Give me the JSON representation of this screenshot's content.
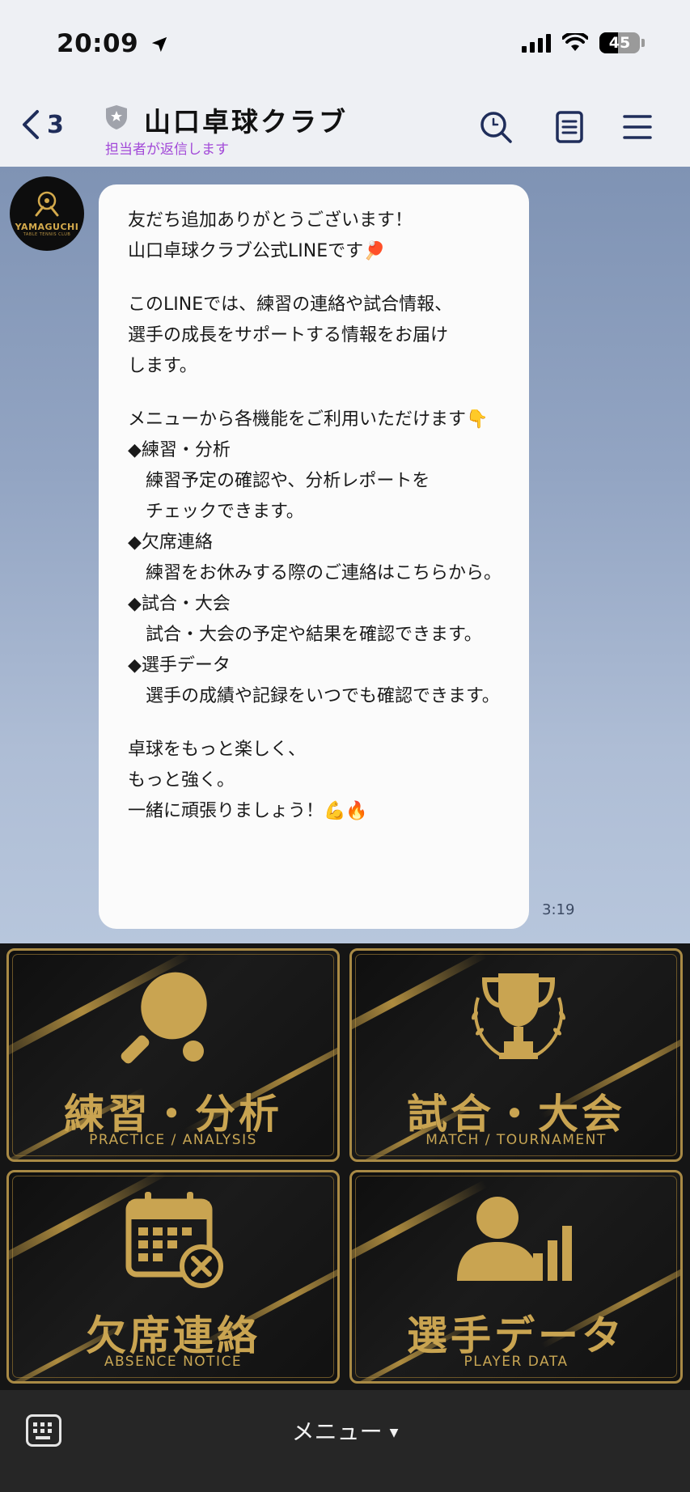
{
  "status": {
    "time": "20:09",
    "battery": "45",
    "battery_level": 0.45
  },
  "header": {
    "back_count": "3",
    "title": "山口卓球クラブ",
    "subtitle": "担当者が返信します"
  },
  "avatar": {
    "logo_text": "YAMAGUCHI",
    "logo_sub": "TABLE TENNIS CLUB"
  },
  "message": {
    "lines": [
      "友だち追加ありがとうございます！",
      "山口卓球クラブ公式LINEです🏓",
      "",
      "このLINEでは、練習の連絡や試合情報、",
      "選手の成長をサポートする情報をお届け",
      "します。",
      "",
      "メニューから各機能をご利用いただけます👇",
      "◆練習・分析",
      "　練習予定の確認や、分析レポートを",
      "　チェックできます。",
      "◆欠席連絡",
      "　練習をお休みする際のご連絡はこちらから。",
      "◆試合・大会",
      "　試合・大会の予定や結果を確認できます。",
      "◆選手データ",
      "　選手の成績や記録をいつでも確認できます。",
      "",
      "卓球をもっと楽しく、",
      "もっと強く。",
      "一緒に頑張りましょう！💪🔥"
    ],
    "time": "3:19"
  },
  "rich_menu": {
    "tiles": [
      {
        "title": "練習・分析",
        "subtitle": "PRACTICE / ANALYSIS",
        "icon": "ping-pong-paddle-icon"
      },
      {
        "title": "試合・大会",
        "subtitle": "MATCH / TOURNAMENT",
        "icon": "trophy-icon"
      },
      {
        "title": "欠席連絡",
        "subtitle": "ABSENCE NOTICE",
        "icon": "calendar-cancel-icon"
      },
      {
        "title": "選手データ",
        "subtitle": "PLAYER DATA",
        "icon": "player-stats-icon"
      }
    ],
    "accent_color": "#c9a451"
  },
  "bottom_bar": {
    "menu_label": "メニュー",
    "caret": "▼"
  }
}
